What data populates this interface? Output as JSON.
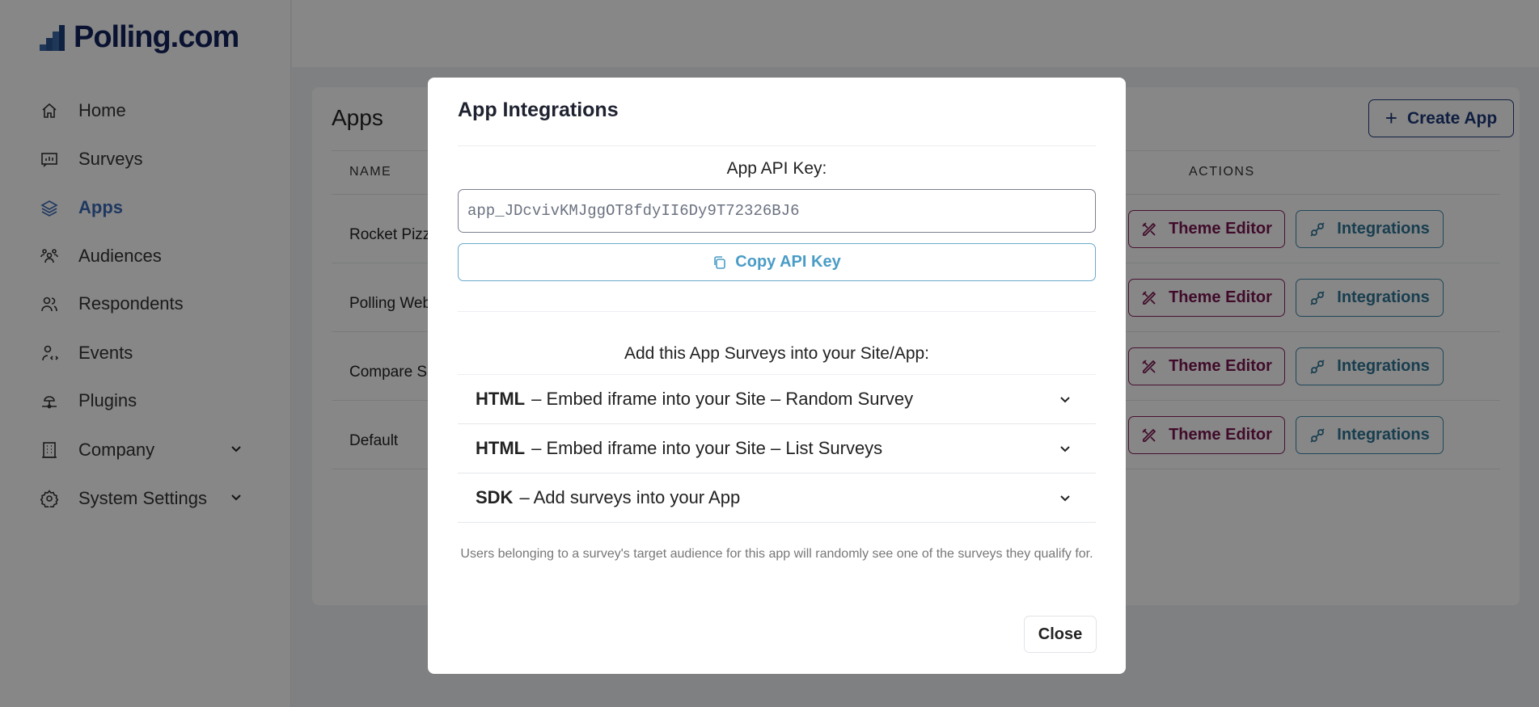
{
  "brand": {
    "name": "Polling.com"
  },
  "sidebar": {
    "items": [
      {
        "label": "Home",
        "icon": "home-icon"
      },
      {
        "label": "Surveys",
        "icon": "chart-icon"
      },
      {
        "label": "Apps",
        "icon": "layers-icon",
        "active": true
      },
      {
        "label": "Audiences",
        "icon": "users-group-icon"
      },
      {
        "label": "Respondents",
        "icon": "users-icon"
      },
      {
        "label": "Events",
        "icon": "user-code-icon"
      },
      {
        "label": "Plugins",
        "icon": "plugin-icon"
      },
      {
        "label": "Company",
        "icon": "building-icon",
        "expandable": true
      },
      {
        "label": "System Settings",
        "icon": "gear-icon",
        "expandable": true
      }
    ]
  },
  "page": {
    "title": "Apps",
    "create_label": "Create App",
    "columns": {
      "name": "NAME",
      "actions": "ACTIONS"
    },
    "rows": [
      {
        "name": "Rocket Pizz"
      },
      {
        "name": "Polling Web"
      },
      {
        "name": "Compare S"
      },
      {
        "name": "Default"
      }
    ],
    "theme_label": "Theme Editor",
    "integrations_label": "Integrations"
  },
  "modal": {
    "title": "App Integrations",
    "api_key_label": "App API Key:",
    "api_key": "app_JDcvivKMJggOT8fdyII6Dy9T72326BJ6",
    "copy_label": "Copy API Key",
    "add_label": "Add this App Surveys into your Site/App:",
    "sections": [
      {
        "tag": "HTML",
        "text": "– Embed iframe into your Site – Random Survey"
      },
      {
        "tag": "HTML",
        "text": "– Embed iframe into your Site – List Surveys"
      },
      {
        "tag": "SDK",
        "text": "– Add surveys into your App"
      }
    ],
    "note": "Users belonging to a survey's target audience for this app will randomly see one of the surveys they qualify for.",
    "close_label": "Close"
  },
  "colors": {
    "brand": "#13235e",
    "active": "#3c6bb8",
    "theme": "#7a1650",
    "integrations": "#2e7596",
    "copy": "#4a9cc6"
  }
}
